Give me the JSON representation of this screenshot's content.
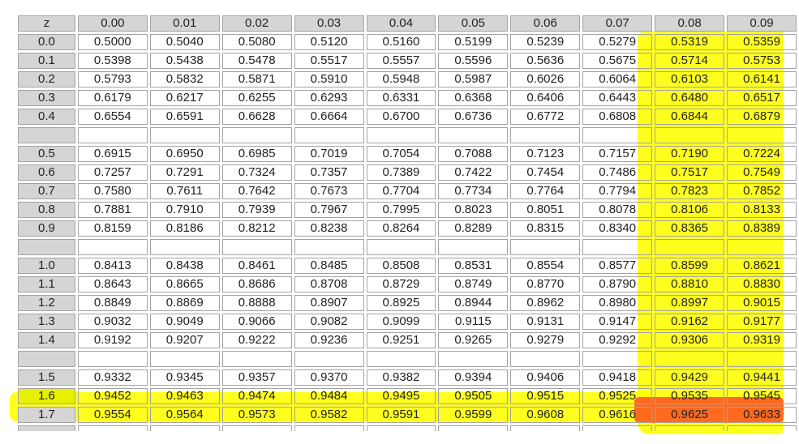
{
  "header": [
    "z",
    "0.00",
    "0.01",
    "0.02",
    "0.03",
    "0.04",
    "0.05",
    "0.06",
    "0.07",
    "0.08",
    "0.09"
  ],
  "rows": [
    {
      "z": "0.0",
      "values": [
        "0.5000",
        "0.5040",
        "0.5080",
        "0.5120",
        "0.5160",
        "0.5199",
        "0.5239",
        "0.5279",
        "0.5319",
        "0.5359"
      ]
    },
    {
      "z": "0.1",
      "values": [
        "0.5398",
        "0.5438",
        "0.5478",
        "0.5517",
        "0.5557",
        "0.5596",
        "0.5636",
        "0.5675",
        "0.5714",
        "0.5753"
      ]
    },
    {
      "z": "0.2",
      "values": [
        "0.5793",
        "0.5832",
        "0.5871",
        "0.5910",
        "0.5948",
        "0.5987",
        "0.6026",
        "0.6064",
        "0.6103",
        "0.6141"
      ]
    },
    {
      "z": "0.3",
      "values": [
        "0.6179",
        "0.6217",
        "0.6255",
        "0.6293",
        "0.6331",
        "0.6368",
        "0.6406",
        "0.6443",
        "0.6480",
        "0.6517"
      ]
    },
    {
      "z": "0.4",
      "values": [
        "0.6554",
        "0.6591",
        "0.6628",
        "0.6664",
        "0.6700",
        "0.6736",
        "0.6772",
        "0.6808",
        "0.6844",
        "0.6879"
      ]
    },
    {
      "blank": true
    },
    {
      "z": "0.5",
      "values": [
        "0.6915",
        "0.6950",
        "0.6985",
        "0.7019",
        "0.7054",
        "0.7088",
        "0.7123",
        "0.7157",
        "0.7190",
        "0.7224"
      ]
    },
    {
      "z": "0.6",
      "values": [
        "0.7257",
        "0.7291",
        "0.7324",
        "0.7357",
        "0.7389",
        "0.7422",
        "0.7454",
        "0.7486",
        "0.7517",
        "0.7549"
      ]
    },
    {
      "z": "0.7",
      "values": [
        "0.7580",
        "0.7611",
        "0.7642",
        "0.7673",
        "0.7704",
        "0.7734",
        "0.7764",
        "0.7794",
        "0.7823",
        "0.7852"
      ]
    },
    {
      "z": "0.8",
      "values": [
        "0.7881",
        "0.7910",
        "0.7939",
        "0.7967",
        "0.7995",
        "0.8023",
        "0.8051",
        "0.8078",
        "0.8106",
        "0.8133"
      ]
    },
    {
      "z": "0.9",
      "values": [
        "0.8159",
        "0.8186",
        "0.8212",
        "0.8238",
        "0.8264",
        "0.8289",
        "0.8315",
        "0.8340",
        "0.8365",
        "0.8389"
      ]
    },
    {
      "blank": true
    },
    {
      "z": "1.0",
      "values": [
        "0.8413",
        "0.8438",
        "0.8461",
        "0.8485",
        "0.8508",
        "0.8531",
        "0.8554",
        "0.8577",
        "0.8599",
        "0.8621"
      ]
    },
    {
      "z": "1.1",
      "values": [
        "0.8643",
        "0.8665",
        "0.8686",
        "0.8708",
        "0.8729",
        "0.8749",
        "0.8770",
        "0.8790",
        "0.8810",
        "0.8830"
      ]
    },
    {
      "z": "1.2",
      "values": [
        "0.8849",
        "0.8869",
        "0.8888",
        "0.8907",
        "0.8925",
        "0.8944",
        "0.8962",
        "0.8980",
        "0.8997",
        "0.9015"
      ]
    },
    {
      "z": "1.3",
      "values": [
        "0.9032",
        "0.9049",
        "0.9066",
        "0.9082",
        "0.9099",
        "0.9115",
        "0.9131",
        "0.9147",
        "0.9162",
        "0.9177"
      ]
    },
    {
      "z": "1.4",
      "values": [
        "0.9192",
        "0.9207",
        "0.9222",
        "0.9236",
        "0.9251",
        "0.9265",
        "0.9279",
        "0.9292",
        "0.9306",
        "0.9319"
      ]
    },
    {
      "blank": true
    },
    {
      "z": "1.5",
      "values": [
        "0.9332",
        "0.9345",
        "0.9357",
        "0.9370",
        "0.9382",
        "0.9394",
        "0.9406",
        "0.9418",
        "0.9429",
        "0.9441"
      ]
    },
    {
      "z": "1.6",
      "values": [
        "0.9452",
        "0.9463",
        "0.9474",
        "0.9484",
        "0.9495",
        "0.9505",
        "0.9515",
        "0.9525",
        "0.9535",
        "0.9545"
      ],
      "highlight": true
    },
    {
      "z": "1.7",
      "values": [
        "0.9554",
        "0.9564",
        "0.9573",
        "0.9582",
        "0.9591",
        "0.9599",
        "0.9608",
        "0.9616",
        "0.9625",
        "0.9633"
      ]
    }
  ],
  "highlights": {
    "columns": [
      "0.08",
      "0.09"
    ],
    "row": "1.6",
    "intersection": [
      "0.9535",
      "0.9545"
    ],
    "column_color": "#ffff00",
    "row_color": "#ffff00",
    "intersection_color": "#ff5a1f"
  }
}
